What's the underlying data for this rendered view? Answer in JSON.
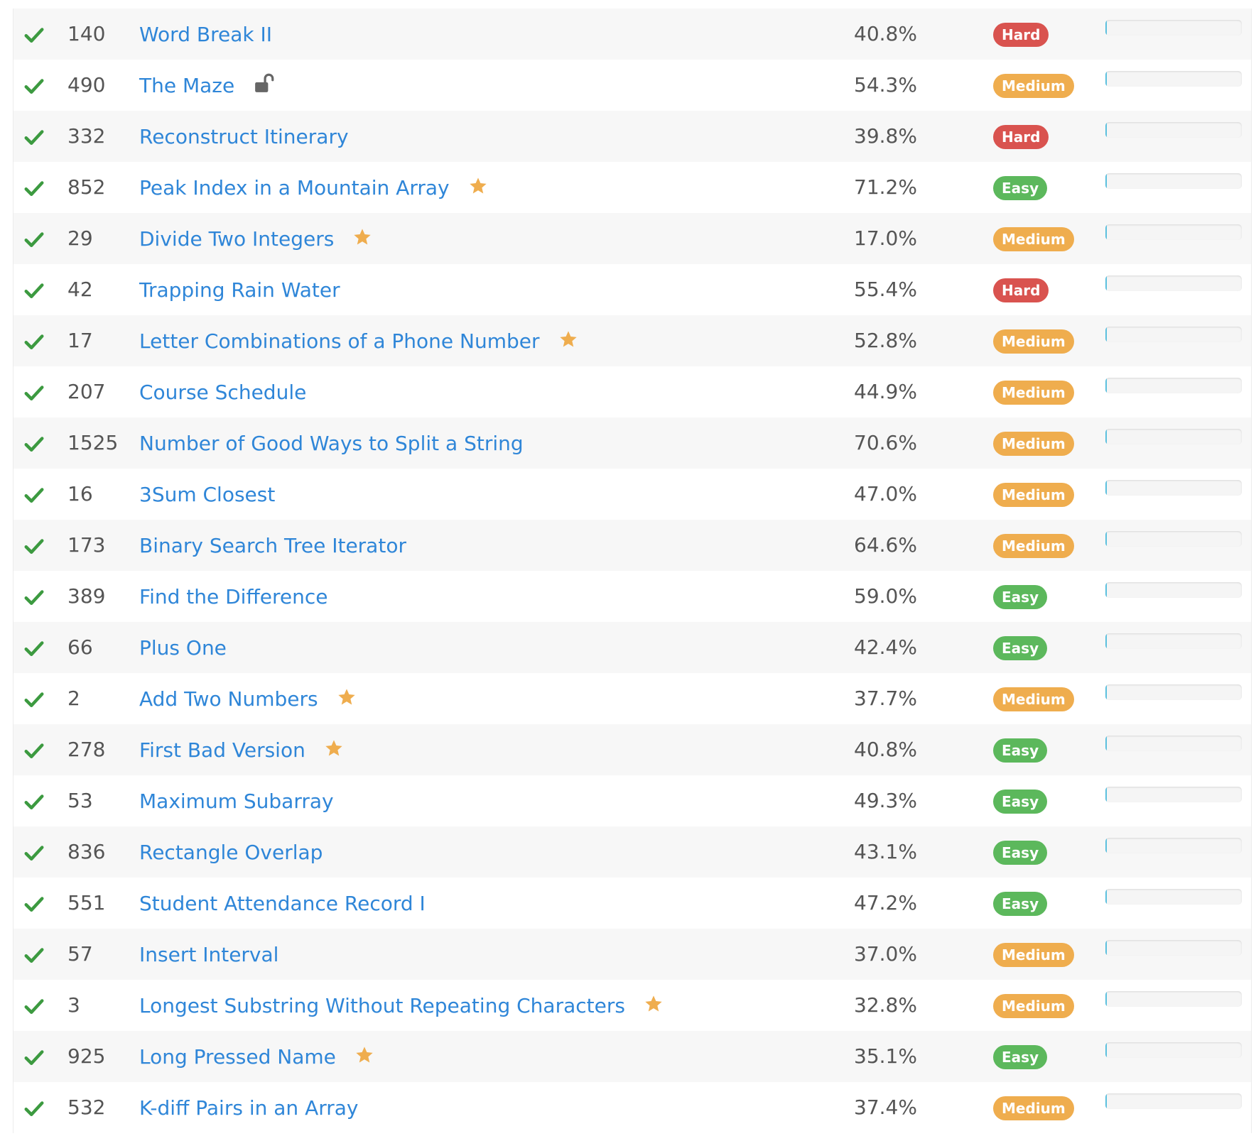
{
  "colors": {
    "link": "#2f86d8",
    "check": "#3c9a40",
    "star": "#efad4e",
    "hard": "#d9534f",
    "medium": "#efad4e",
    "easy": "#5cb85c"
  },
  "problems": [
    {
      "id": "140",
      "title": "Word Break II",
      "acceptance": "40.8%",
      "difficulty": "Hard",
      "starred": false,
      "locked": false,
      "progress": 0.01
    },
    {
      "id": "490",
      "title": "The Maze",
      "acceptance": "54.3%",
      "difficulty": "Medium",
      "starred": false,
      "locked": true,
      "progress": 0.01
    },
    {
      "id": "332",
      "title": "Reconstruct Itinerary",
      "acceptance": "39.8%",
      "difficulty": "Hard",
      "starred": false,
      "locked": false,
      "progress": 0.01
    },
    {
      "id": "852",
      "title": "Peak Index in a Mountain Array",
      "acceptance": "71.2%",
      "difficulty": "Easy",
      "starred": true,
      "locked": false,
      "progress": 0.01
    },
    {
      "id": "29",
      "title": "Divide Two Integers",
      "acceptance": "17.0%",
      "difficulty": "Medium",
      "starred": true,
      "locked": false,
      "progress": 0.01
    },
    {
      "id": "42",
      "title": "Trapping Rain Water",
      "acceptance": "55.4%",
      "difficulty": "Hard",
      "starred": false,
      "locked": false,
      "progress": 0.01
    },
    {
      "id": "17",
      "title": "Letter Combinations of a Phone Number",
      "acceptance": "52.8%",
      "difficulty": "Medium",
      "starred": true,
      "locked": false,
      "progress": 0.01
    },
    {
      "id": "207",
      "title": "Course Schedule",
      "acceptance": "44.9%",
      "difficulty": "Medium",
      "starred": false,
      "locked": false,
      "progress": 0.01
    },
    {
      "id": "1525",
      "title": "Number of Good Ways to Split a String",
      "acceptance": "70.6%",
      "difficulty": "Medium",
      "starred": false,
      "locked": false,
      "progress": 0.01
    },
    {
      "id": "16",
      "title": "3Sum Closest",
      "acceptance": "47.0%",
      "difficulty": "Medium",
      "starred": false,
      "locked": false,
      "progress": 0.01
    },
    {
      "id": "173",
      "title": "Binary Search Tree Iterator",
      "acceptance": "64.6%",
      "difficulty": "Medium",
      "starred": false,
      "locked": false,
      "progress": 0.01
    },
    {
      "id": "389",
      "title": "Find the Difference",
      "acceptance": "59.0%",
      "difficulty": "Easy",
      "starred": false,
      "locked": false,
      "progress": 0.01
    },
    {
      "id": "66",
      "title": "Plus One",
      "acceptance": "42.4%",
      "difficulty": "Easy",
      "starred": false,
      "locked": false,
      "progress": 0.01
    },
    {
      "id": "2",
      "title": "Add Two Numbers",
      "acceptance": "37.7%",
      "difficulty": "Medium",
      "starred": true,
      "locked": false,
      "progress": 0.01
    },
    {
      "id": "278",
      "title": "First Bad Version",
      "acceptance": "40.8%",
      "difficulty": "Easy",
      "starred": true,
      "locked": false,
      "progress": 0.01
    },
    {
      "id": "53",
      "title": "Maximum Subarray",
      "acceptance": "49.3%",
      "difficulty": "Easy",
      "starred": false,
      "locked": false,
      "progress": 0.01
    },
    {
      "id": "836",
      "title": "Rectangle Overlap",
      "acceptance": "43.1%",
      "difficulty": "Easy",
      "starred": false,
      "locked": false,
      "progress": 0.01
    },
    {
      "id": "551",
      "title": "Student Attendance Record I",
      "acceptance": "47.2%",
      "difficulty": "Easy",
      "starred": false,
      "locked": false,
      "progress": 0.01
    },
    {
      "id": "57",
      "title": "Insert Interval",
      "acceptance": "37.0%",
      "difficulty": "Medium",
      "starred": false,
      "locked": false,
      "progress": 0.01
    },
    {
      "id": "3",
      "title": "Longest Substring Without Repeating Characters",
      "acceptance": "32.8%",
      "difficulty": "Medium",
      "starred": true,
      "locked": false,
      "progress": 0.01
    },
    {
      "id": "925",
      "title": "Long Pressed Name",
      "acceptance": "35.1%",
      "difficulty": "Easy",
      "starred": true,
      "locked": false,
      "progress": 0.01
    },
    {
      "id": "532",
      "title": "K-diff Pairs in an Array",
      "acceptance": "37.4%",
      "difficulty": "Medium",
      "starred": false,
      "locked": false,
      "progress": 0.01
    }
  ]
}
